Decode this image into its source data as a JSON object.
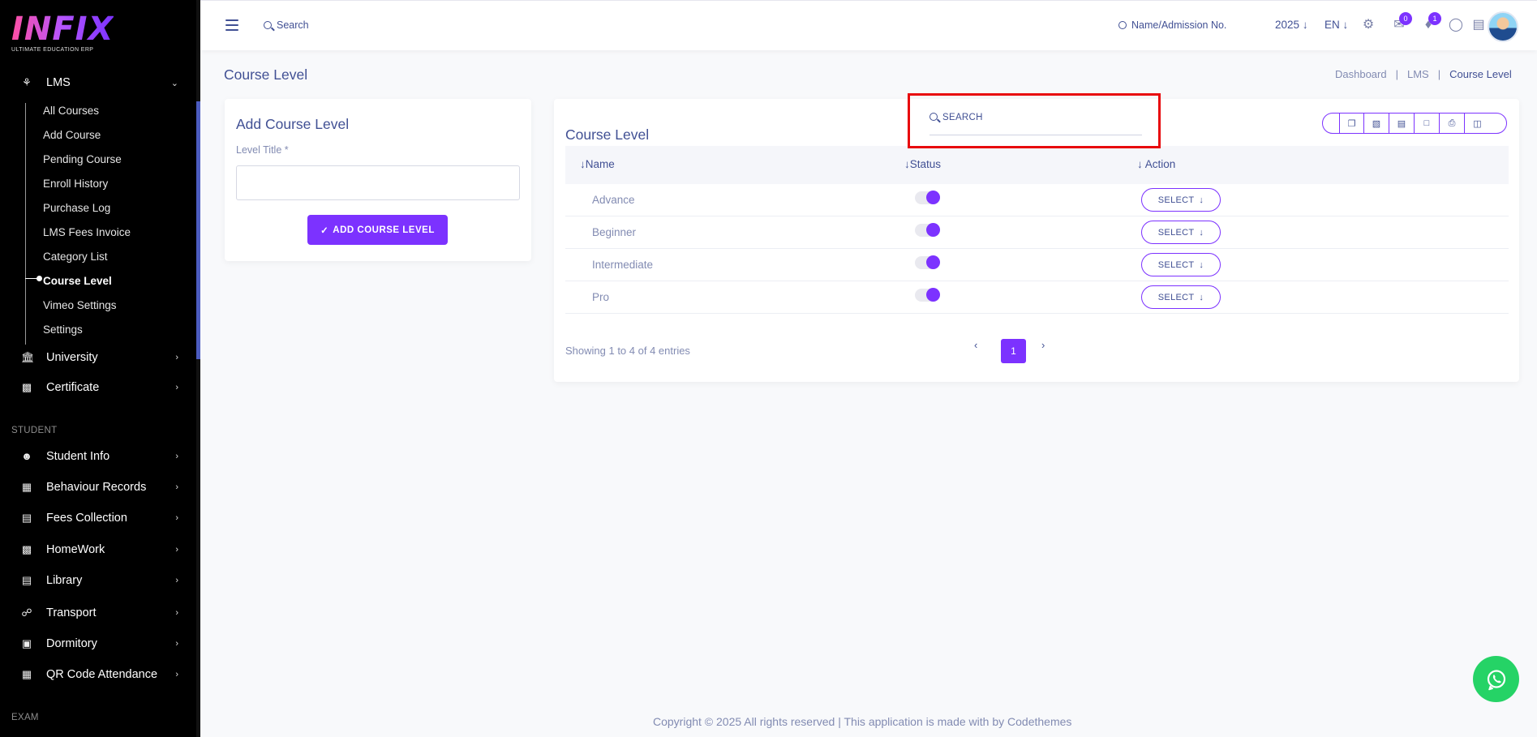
{
  "app": {
    "logo_text": "INFIX",
    "logo_tagline": "ULTIMATE EDUCATION ERP"
  },
  "sidebar": {
    "lms": {
      "label": "LMS",
      "icon": "person-icon"
    },
    "lms_items": [
      "All Courses",
      "Add Course",
      "Pending Course",
      "Enroll History",
      "Purchase Log",
      "LMS Fees Invoice",
      "Category List",
      "Course Level",
      "Vimeo Settings",
      "Settings"
    ],
    "active_item": "Course Level",
    "university": "University",
    "certificate": "Certificate",
    "section_student": "STUDENT",
    "student_menu": [
      "Student Info",
      "Behaviour Records",
      "Fees Collection",
      "HomeWork",
      "Library",
      "Transport",
      "Dormitory",
      "QR Code Attendance"
    ],
    "section_exam": "EXAM"
  },
  "header": {
    "search_label": "Search",
    "admission_search": "Name/Admission No.",
    "year": "2025",
    "language": "EN",
    "chat_badge": "0",
    "notification_badge": "1"
  },
  "page": {
    "title": "Course Level",
    "breadcrumb": [
      "Dashboard",
      "LMS",
      "Course Level"
    ]
  },
  "add_form": {
    "title": "Add Course Level",
    "field_label": "Level Title *",
    "field_value": "",
    "submit_label": "ADD COURSE LEVEL"
  },
  "list": {
    "title": "Course Level",
    "search_placeholder": "SEARCH",
    "columns": [
      "Name",
      "Status",
      "Action"
    ],
    "rows": [
      {
        "name": "Advance",
        "status": true,
        "action": "SELECT"
      },
      {
        "name": "Beginner",
        "status": true,
        "action": "SELECT"
      },
      {
        "name": "Intermediate",
        "status": true,
        "action": "SELECT"
      },
      {
        "name": "Pro",
        "status": true,
        "action": "SELECT"
      }
    ],
    "summary": "Showing 1 to 4 of 4 entries",
    "current_page": "1",
    "tools": [
      "copy-icon",
      "excel-icon",
      "csv-icon",
      "pdf-icon",
      "print-icon",
      "columns-icon"
    ]
  },
  "footer": {
    "text": "Copyright © 2025 All rights reserved | This application is made with by Codethemes"
  },
  "colors": {
    "accent": "#7c32ff",
    "text": "#415094",
    "muted": "#828bb2",
    "highlight": "#e8090d",
    "whatsapp": "#25d366"
  }
}
